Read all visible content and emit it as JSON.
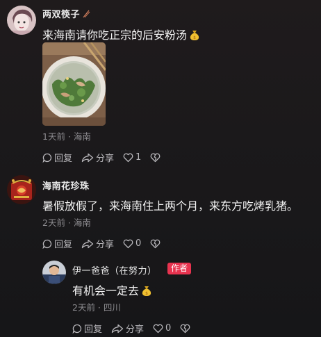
{
  "comments": [
    {
      "username": "两双筷子",
      "text": "来海南请你吃正宗的后安粉汤",
      "meta": "1天前 · 海南",
      "reply_label": "回复",
      "share_label": "分享",
      "like_count": "1"
    },
    {
      "username": "海南花珍珠",
      "text": "暑假放假了，来海南住上两个月，来东方吃烤乳猪。",
      "meta": "2天前 · 海南",
      "reply_label": "回复",
      "share_label": "分享",
      "like_count": "0"
    },
    {
      "username": "伊一爸爸（在努力）",
      "author_badge": "作者",
      "text": "有机会一定去",
      "meta": "2天前 · 四川",
      "reply_label": "回复",
      "share_label": "分享",
      "like_count": "0"
    }
  ],
  "colors": {
    "badge": "#e8334f",
    "meta": "#8d8c90",
    "background": "#1d1a1c"
  },
  "icons": {
    "comment": "speech-bubble-icon",
    "share": "share-arrow-icon",
    "like": "heart-icon",
    "dislike": "broken-heart-icon",
    "emoji": "money-bag-emoji"
  }
}
